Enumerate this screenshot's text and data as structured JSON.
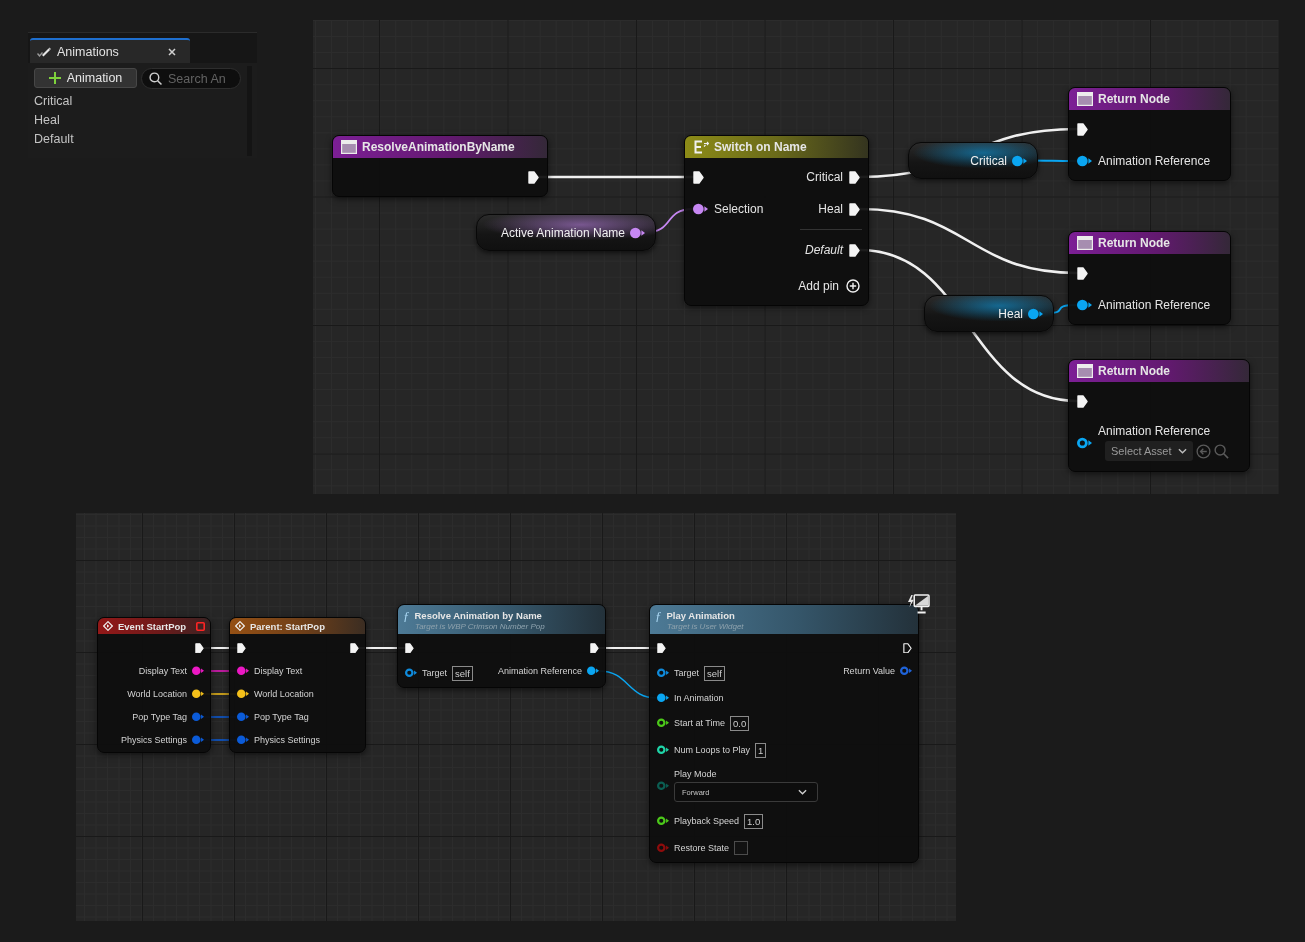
{
  "animations_panel": {
    "tab": {
      "label": "Animations",
      "selected": true
    },
    "add_button": {
      "label": "Animation"
    },
    "search": {
      "placeholder": "Search An"
    },
    "items": [
      "Critical",
      "Heal",
      "Default"
    ]
  },
  "graphs": [
    {
      "nodes": [
        {
          "kind": "function_entry",
          "title": "ResolveAnimationByName",
          "outputs": [
            {
              "kind": "exec",
              "connected": true
            }
          ]
        },
        {
          "kind": "variable",
          "label": "Active Animation Name",
          "pin": {
            "kind": "data",
            "color": "#c687f2",
            "connected": true
          }
        },
        {
          "kind": "switch",
          "title": "Switch on Name",
          "inputs": [
            {
              "kind": "exec",
              "connected": true
            },
            {
              "kind": "data",
              "label": "Selection",
              "color": "#c687f2",
              "connected": true
            }
          ],
          "outputs": [
            {
              "kind": "exec",
              "label": "Critical",
              "connected": true
            },
            {
              "kind": "exec",
              "label": "Heal",
              "connected": true
            }
          ],
          "default_output": {
            "kind": "exec",
            "label": "Default",
            "connected": true
          },
          "add_pin": "Add pin"
        },
        {
          "kind": "variable",
          "label": "Critical",
          "pin": {
            "kind": "data",
            "color": "#0aa6f2",
            "connected": true
          }
        },
        {
          "kind": "return",
          "title": "Return Node",
          "inputs": [
            {
              "kind": "exec",
              "connected": true
            },
            {
              "kind": "data",
              "label": "Animation Reference",
              "color": "#0aa6f2",
              "connected": true
            }
          ]
        },
        {
          "kind": "return",
          "title": "Return Node",
          "inputs": [
            {
              "kind": "exec",
              "connected": true
            },
            {
              "kind": "data",
              "label": "Animation Reference",
              "color": "#0aa6f2",
              "connected": true
            }
          ]
        },
        {
          "kind": "variable",
          "label": "Heal",
          "pin": {
            "kind": "data",
            "color": "#0aa6f2",
            "connected": true
          }
        },
        {
          "kind": "return",
          "title": "Return Node",
          "inputs": [
            {
              "kind": "exec",
              "connected": true
            },
            {
              "kind": "data",
              "label": "Animation Reference",
              "color": "#0aa6f2",
              "connected": false,
              "input": {
                "kind": "asset",
                "value": "Select Asset"
              }
            }
          ]
        }
      ]
    },
    {
      "nodes": [
        {
          "kind": "event",
          "title": "Event StartPop",
          "delegate_pin": {
            "color": "#ff2424",
            "connected": false
          },
          "outputs": [
            {
              "kind": "exec",
              "connected": true
            },
            {
              "kind": "data",
              "label": "Display Text",
              "color": "#ec18c4",
              "connected": true
            },
            {
              "kind": "data",
              "label": "World Location",
              "color": "#f5c01a",
              "connected": true
            },
            {
              "kind": "data",
              "label": "Pop Type Tag",
              "color": "#0b5bd8",
              "connected": true
            },
            {
              "kind": "data",
              "label": "Physics Settings",
              "color": "#0b5bd8",
              "connected": true
            }
          ]
        },
        {
          "kind": "parent_call",
          "title": "Parent: StartPop",
          "inputs": [
            {
              "kind": "exec",
              "connected": true
            },
            {
              "kind": "data",
              "label": "Display Text",
              "color": "#ec18c4",
              "connected": true
            },
            {
              "kind": "data",
              "label": "World Location",
              "color": "#f5c01a",
              "connected": true
            },
            {
              "kind": "data",
              "label": "Pop Type Tag",
              "color": "#0b5bd8",
              "connected": true
            },
            {
              "kind": "data",
              "label": "Physics Settings",
              "color": "#0b5bd8",
              "connected": true
            }
          ],
          "outputs": [
            {
              "kind": "exec",
              "connected": true
            }
          ]
        },
        {
          "kind": "call",
          "icon_glyph": "ƒ",
          "title": "Resolve Animation by Name",
          "subtitle": "Target is WBP Crimson Number Pop",
          "inputs": [
            {
              "kind": "exec",
              "connected": true
            },
            {
              "kind": "data",
              "label": "Target",
              "color": "#0f8bdc",
              "connected": false,
              "input": {
                "kind": "text",
                "value": "self"
              }
            }
          ],
          "outputs": [
            {
              "kind": "exec",
              "connected": true
            },
            {
              "kind": "data",
              "label": "Animation Reference",
              "color": "#0aa6f2",
              "connected": true
            }
          ]
        },
        {
          "kind": "call",
          "icon_glyph": "ƒ",
          "title": "Play Animation",
          "subtitle": "Target is User Widget",
          "cosmetic": true,
          "inputs": [
            {
              "kind": "exec",
              "connected": true
            },
            {
              "kind": "data",
              "label": "Target",
              "color": "#0f8bdc",
              "connected": false,
              "input": {
                "kind": "text",
                "value": "self"
              }
            },
            {
              "kind": "data",
              "label": "In Animation",
              "color": "#0aa6f2",
              "connected": true
            },
            {
              "kind": "data",
              "label": "Start at Time",
              "color": "#4cc91a",
              "connected": false,
              "input": {
                "kind": "text",
                "value": "0.0"
              }
            },
            {
              "kind": "data",
              "label": "Num Loops to Play",
              "color": "#1fd5a8",
              "connected": false,
              "input": {
                "kind": "text",
                "value": "1"
              }
            },
            {
              "kind": "data",
              "label": "Play Mode",
              "color": "#0b5e52",
              "connected": false,
              "input": {
                "kind": "dropdown",
                "value": "Forward"
              }
            },
            {
              "kind": "data",
              "label": "Playback Speed",
              "color": "#4cc91a",
              "connected": false,
              "input": {
                "kind": "text",
                "value": "1.0"
              }
            },
            {
              "kind": "data",
              "label": "Restore State",
              "color": "#8e0c0c",
              "connected": false,
              "input": {
                "kind": "checkbox",
                "checked": false
              }
            }
          ],
          "outputs": [
            {
              "kind": "exec",
              "connected": false
            },
            {
              "kind": "data",
              "label": "Return Value",
              "color": "#1f63d9",
              "connected": false
            }
          ]
        }
      ]
    }
  ]
}
